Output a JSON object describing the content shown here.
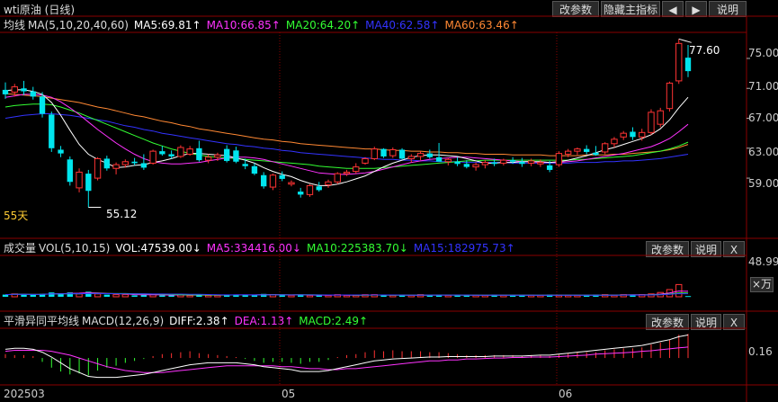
{
  "title": "wti原油 (日线)",
  "toolbar": {
    "modify": "改参数",
    "hide_main": "隐藏主指标",
    "explain": "说明"
  },
  "price_panel": {
    "label": "均线",
    "params": "MA(5,10,20,40,60)",
    "ma5": "MA5:69.81↑",
    "ma10": "MA10:66.85↑",
    "ma20": "MA20:64.20↑",
    "ma40": "MA40:62.58↑",
    "ma60": "MA60:63.46↑",
    "y_ticks": [
      "75.00",
      "71.00",
      "67.00",
      "63.00",
      "59.00"
    ],
    "high_label": "77.60",
    "low_label": "55.12",
    "period_label": "55天"
  },
  "volume_panel": {
    "label": "成交量",
    "params": "VOL(5,10,15)",
    "vol": "VOL:47539.00↓",
    "ma5": "MA5:334416.00↓",
    "ma10": "MA10:225383.70↓",
    "ma15": "MA15:182975.73↑",
    "modify": "改参数",
    "explain": "说明",
    "close": "X",
    "y_tick": "48.99",
    "unit_label": "×万"
  },
  "macd_panel": {
    "label": "平滑异同平均线",
    "params": "MACD(12,26,9)",
    "diff": "DIFF:2.38↑",
    "dea": "DEA:1.13↑",
    "macd": "MACD:2.49↑",
    "modify": "改参数",
    "explain": "说明",
    "close": "X",
    "y_tick": "0.16"
  },
  "x_labels": [
    "202503",
    "05",
    "06"
  ],
  "colors": {
    "up": "#ff3333",
    "down": "#00e5ee",
    "ma5": "#ffffff",
    "ma10": "#ff33ff",
    "ma20": "#33ff33",
    "ma40": "#3333ff",
    "ma60": "#ff8833",
    "grid": "#8a0000"
  },
  "chart_data": {
    "type": "candlestick",
    "ylim": [
      53,
      78
    ],
    "candles": [
      {
        "o": 70.8,
        "h": 71.8,
        "l": 69.6,
        "c": 70.2
      },
      {
        "o": 70.5,
        "h": 71.6,
        "l": 69.9,
        "c": 71.2
      },
      {
        "o": 71.0,
        "h": 72.0,
        "l": 70.1,
        "c": 70.6
      },
      {
        "o": 70.6,
        "h": 71.2,
        "l": 69.5,
        "c": 69.9
      },
      {
        "o": 69.9,
        "h": 70.5,
        "l": 67.1,
        "c": 67.6
      },
      {
        "o": 67.5,
        "h": 67.9,
        "l": 62.5,
        "c": 63.0
      },
      {
        "o": 62.8,
        "h": 63.3,
        "l": 61.8,
        "c": 62.3
      },
      {
        "o": 61.5,
        "h": 61.9,
        "l": 58.0,
        "c": 58.5
      },
      {
        "o": 57.7,
        "h": 60.3,
        "l": 57.1,
        "c": 59.8
      },
      {
        "o": 59.6,
        "h": 60.1,
        "l": 55.1,
        "c": 57.3
      },
      {
        "o": 59.0,
        "h": 61.8,
        "l": 58.7,
        "c": 61.6
      },
      {
        "o": 61.6,
        "h": 62.0,
        "l": 60.0,
        "c": 60.3
      },
      {
        "o": 60.3,
        "h": 61.1,
        "l": 59.5,
        "c": 60.8
      },
      {
        "o": 60.8,
        "h": 61.5,
        "l": 60.4,
        "c": 61.2
      },
      {
        "o": 61.2,
        "h": 61.7,
        "l": 60.7,
        "c": 61.0
      },
      {
        "o": 61.0,
        "h": 62.2,
        "l": 60.1,
        "c": 60.4
      },
      {
        "o": 61.0,
        "h": 62.8,
        "l": 60.8,
        "c": 62.6
      },
      {
        "o": 62.6,
        "h": 63.3,
        "l": 62.0,
        "c": 62.2
      },
      {
        "o": 62.2,
        "h": 62.7,
        "l": 61.6,
        "c": 61.9
      },
      {
        "o": 61.9,
        "h": 63.4,
        "l": 61.7,
        "c": 63.1
      },
      {
        "o": 62.2,
        "h": 63.3,
        "l": 62.0,
        "c": 62.9
      },
      {
        "o": 63.0,
        "h": 64.0,
        "l": 61.2,
        "c": 61.4
      },
      {
        "o": 61.4,
        "h": 62.2,
        "l": 61.0,
        "c": 61.8
      },
      {
        "o": 61.8,
        "h": 62.4,
        "l": 61.3,
        "c": 62.1
      },
      {
        "o": 62.9,
        "h": 63.4,
        "l": 61.1,
        "c": 61.3
      },
      {
        "o": 62.7,
        "h": 63.2,
        "l": 61.0,
        "c": 61.2
      },
      {
        "o": 60.9,
        "h": 61.6,
        "l": 60.2,
        "c": 60.6
      },
      {
        "o": 60.6,
        "h": 61.0,
        "l": 59.4,
        "c": 59.6
      },
      {
        "o": 59.4,
        "h": 59.8,
        "l": 57.6,
        "c": 57.9
      },
      {
        "o": 57.8,
        "h": 59.6,
        "l": 57.4,
        "c": 59.4
      },
      {
        "o": 59.4,
        "h": 59.9,
        "l": 58.6,
        "c": 58.9
      },
      {
        "o": 58.2,
        "h": 58.7,
        "l": 57.9,
        "c": 58.4
      },
      {
        "o": 57.2,
        "h": 57.7,
        "l": 56.4,
        "c": 56.8
      },
      {
        "o": 56.8,
        "h": 58.2,
        "l": 56.5,
        "c": 58.0
      },
      {
        "o": 57.9,
        "h": 58.5,
        "l": 57.2,
        "c": 57.4
      },
      {
        "o": 58.1,
        "h": 58.8,
        "l": 57.7,
        "c": 58.5
      },
      {
        "o": 58.5,
        "h": 59.8,
        "l": 58.2,
        "c": 59.6
      },
      {
        "o": 59.6,
        "h": 60.1,
        "l": 59.3,
        "c": 59.8
      },
      {
        "o": 59.9,
        "h": 61.0,
        "l": 59.6,
        "c": 60.5
      },
      {
        "o": 61.0,
        "h": 61.8,
        "l": 60.8,
        "c": 61.6
      },
      {
        "o": 61.6,
        "h": 63.2,
        "l": 61.4,
        "c": 62.9
      },
      {
        "o": 62.9,
        "h": 63.0,
        "l": 61.7,
        "c": 61.9
      },
      {
        "o": 62.0,
        "h": 63.1,
        "l": 61.7,
        "c": 62.8
      },
      {
        "o": 62.8,
        "h": 63.0,
        "l": 61.5,
        "c": 61.6
      },
      {
        "o": 61.6,
        "h": 62.2,
        "l": 61.1,
        "c": 61.9
      },
      {
        "o": 61.9,
        "h": 62.6,
        "l": 61.4,
        "c": 62.3
      },
      {
        "o": 62.3,
        "h": 62.8,
        "l": 61.6,
        "c": 61.8
      },
      {
        "o": 61.8,
        "h": 63.7,
        "l": 61.5,
        "c": 61.2
      },
      {
        "o": 61.2,
        "h": 61.7,
        "l": 60.7,
        "c": 61.5
      },
      {
        "o": 61.2,
        "h": 61.8,
        "l": 60.6,
        "c": 60.9
      },
      {
        "o": 60.9,
        "h": 61.4,
        "l": 60.3,
        "c": 60.5
      },
      {
        "o": 60.5,
        "h": 61.1,
        "l": 60.0,
        "c": 60.8
      },
      {
        "o": 60.8,
        "h": 61.4,
        "l": 60.3,
        "c": 61.1
      },
      {
        "o": 61.1,
        "h": 61.6,
        "l": 60.6,
        "c": 60.9
      },
      {
        "o": 61.0,
        "h": 61.6,
        "l": 60.7,
        "c": 61.4
      },
      {
        "o": 61.4,
        "h": 61.8,
        "l": 60.9,
        "c": 61.2
      },
      {
        "o": 61.2,
        "h": 61.7,
        "l": 60.5,
        "c": 60.9
      },
      {
        "o": 61.0,
        "h": 61.6,
        "l": 60.6,
        "c": 61.3
      },
      {
        "o": 60.9,
        "h": 61.5,
        "l": 60.5,
        "c": 61.1
      },
      {
        "o": 60.7,
        "h": 61.3,
        "l": 59.8,
        "c": 60.1
      },
      {
        "o": 60.8,
        "h": 62.6,
        "l": 60.5,
        "c": 62.3
      },
      {
        "o": 62.2,
        "h": 62.9,
        "l": 61.8,
        "c": 62.6
      },
      {
        "o": 62.6,
        "h": 63.1,
        "l": 62.1,
        "c": 62.9
      },
      {
        "o": 62.9,
        "h": 63.4,
        "l": 62.2,
        "c": 62.5
      },
      {
        "o": 62.4,
        "h": 63.3,
        "l": 62.0,
        "c": 62.1
      },
      {
        "o": 62.5,
        "h": 63.8,
        "l": 62.2,
        "c": 63.6
      },
      {
        "o": 63.6,
        "h": 64.5,
        "l": 63.1,
        "c": 64.2
      },
      {
        "o": 64.5,
        "h": 65.3,
        "l": 64.1,
        "c": 65.0
      },
      {
        "o": 65.2,
        "h": 65.8,
        "l": 64.1,
        "c": 64.5
      },
      {
        "o": 64.5,
        "h": 65.6,
        "l": 64.0,
        "c": 65.1
      },
      {
        "o": 65.1,
        "h": 68.2,
        "l": 64.8,
        "c": 67.8
      },
      {
        "o": 66.2,
        "h": 68.4,
        "l": 65.8,
        "c": 68.0
      },
      {
        "o": 68.3,
        "h": 71.9,
        "l": 67.9,
        "c": 71.7
      },
      {
        "o": 72.0,
        "h": 77.6,
        "l": 71.6,
        "c": 77.0
      },
      {
        "o": 75.1,
        "h": 76.8,
        "l": 72.5,
        "c": 73.3
      }
    ],
    "ma5": [
      70.7,
      70.8,
      70.8,
      70.6,
      70.2,
      69.1,
      67.4,
      65.4,
      63.5,
      62.2,
      61.5,
      61.0,
      60.4,
      60.5,
      60.7,
      60.8,
      61.1,
      61.3,
      61.6,
      62.0,
      62.3,
      62.3,
      62.2,
      62.1,
      62.0,
      61.7,
      61.4,
      61.0,
      60.4,
      59.9,
      59.5,
      59.2,
      58.7,
      58.3,
      58.0,
      58.0,
      58.2,
      58.5,
      58.9,
      59.3,
      59.9,
      60.5,
      61.0,
      61.4,
      61.8,
      62.0,
      62.1,
      62.1,
      62.0,
      61.9,
      61.6,
      61.3,
      61.0,
      61.0,
      61.1,
      61.1,
      61.2,
      61.2,
      61.2,
      61.1,
      61.2,
      61.4,
      61.7,
      62.0,
      62.4,
      62.8,
      63.1,
      63.5,
      63.9,
      64.3,
      64.8,
      65.6,
      66.8,
      68.4,
      69.8
    ],
    "ma10": [
      69.8,
      70.0,
      70.2,
      70.2,
      70.1,
      69.8,
      69.2,
      68.4,
      67.5,
      66.5,
      65.5,
      64.6,
      63.7,
      62.9,
      62.2,
      61.6,
      61.2,
      61.0,
      60.9,
      60.9,
      61.0,
      61.1,
      61.3,
      61.5,
      61.7,
      61.8,
      61.8,
      61.7,
      61.5,
      61.2,
      60.9,
      60.6,
      60.3,
      60.0,
      59.7,
      59.6,
      59.5,
      59.5,
      59.6,
      59.7,
      59.9,
      60.2,
      60.5,
      60.8,
      61.1,
      61.3,
      61.5,
      61.6,
      61.7,
      61.8,
      61.8,
      61.7,
      61.6,
      61.5,
      61.4,
      61.3,
      61.2,
      61.2,
      61.1,
      61.1,
      61.1,
      61.2,
      61.3,
      61.5,
      61.7,
      61.9,
      62.1,
      62.3,
      62.6,
      62.9,
      63.2,
      63.7,
      64.3,
      65.2,
      66.2
    ],
    "ma20": [
      68.5,
      68.7,
      68.8,
      68.9,
      68.9,
      68.8,
      68.5,
      68.1,
      67.7,
      67.2,
      66.7,
      66.2,
      65.7,
      65.2,
      64.7,
      64.2,
      63.7,
      63.3,
      62.9,
      62.6,
      62.3,
      62.1,
      61.9,
      61.8,
      61.7,
      61.6,
      61.5,
      61.4,
      61.3,
      61.2,
      61.1,
      61.0,
      60.9,
      60.8,
      60.6,
      60.5,
      60.4,
      60.3,
      60.3,
      60.3,
      60.3,
      60.4,
      60.5,
      60.6,
      60.7,
      60.8,
      60.9,
      61.0,
      61.1,
      61.2,
      61.3,
      61.3,
      61.4,
      61.4,
      61.4,
      61.4,
      61.4,
      61.4,
      61.4,
      61.4,
      61.4,
      61.4,
      61.5,
      61.5,
      61.6,
      61.7,
      61.8,
      61.9,
      62.0,
      62.2,
      62.4,
      62.6,
      62.9,
      63.3,
      63.8
    ],
    "ma40": [
      67.0,
      67.2,
      67.4,
      67.5,
      67.6,
      67.6,
      67.5,
      67.4,
      67.2,
      67.0,
      66.8,
      66.6,
      66.3,
      66.0,
      65.8,
      65.5,
      65.3,
      65.0,
      64.8,
      64.6,
      64.4,
      64.2,
      64.0,
      63.8,
      63.6,
      63.5,
      63.3,
      63.2,
      63.0,
      62.9,
      62.7,
      62.6,
      62.4,
      62.3,
      62.2,
      62.1,
      62.0,
      61.9,
      61.8,
      61.7,
      61.6,
      61.5,
      61.5,
      61.4,
      61.4,
      61.3,
      61.3,
      61.2,
      61.2,
      61.2,
      61.1,
      61.1,
      61.1,
      61.1,
      61.1,
      61.0,
      61.0,
      61.0,
      61.0,
      61.0,
      61.0,
      61.0,
      61.1,
      61.1,
      61.1,
      61.2,
      61.2,
      61.3,
      61.3,
      61.4,
      61.5,
      61.6,
      61.8,
      62.0,
      62.2
    ],
    "ma60": [
      70.3,
      70.2,
      70.1,
      70.0,
      69.9,
      69.7,
      69.5,
      69.3,
      69.1,
      68.8,
      68.5,
      68.3,
      68.0,
      67.7,
      67.4,
      67.2,
      66.9,
      66.6,
      66.4,
      66.1,
      65.9,
      65.6,
      65.4,
      65.2,
      65.0,
      64.8,
      64.6,
      64.4,
      64.2,
      64.1,
      63.9,
      63.8,
      63.6,
      63.5,
      63.4,
      63.3,
      63.2,
      63.1,
      63.0,
      62.9,
      62.9,
      62.8,
      62.7,
      62.7,
      62.6,
      62.6,
      62.5,
      62.5,
      62.4,
      62.4,
      62.3,
      62.3,
      62.2,
      62.2,
      62.2,
      62.1,
      62.1,
      62.1,
      62.1,
      62.0,
      62.0,
      62.0,
      62.0,
      62.1,
      62.1,
      62.1,
      62.2,
      62.2,
      62.3,
      62.4,
      62.5,
      62.6,
      62.8,
      63.1,
      63.5
    ],
    "volume_ylim": [
      0,
      50
    ],
    "volume": [
      3,
      4,
      3,
      3,
      4,
      6,
      5,
      6,
      4,
      7,
      4,
      3,
      3,
      3,
      2,
      3,
      3,
      2,
      2,
      3,
      2,
      3,
      2,
      2,
      3,
      3,
      3,
      2,
      4,
      3,
      2,
      2,
      3,
      2,
      2,
      2,
      3,
      2,
      2,
      3,
      3,
      2,
      2,
      2,
      2,
      3,
      2,
      3,
      2,
      2,
      2,
      2,
      2,
      3,
      2,
      2,
      2,
      2,
      2,
      3,
      2,
      2,
      2,
      2,
      3,
      3,
      2,
      3,
      3,
      3,
      4,
      6,
      10,
      17,
      1
    ],
    "macd_ylim": [
      -2.6,
      2.8
    ],
    "macd_bars": [
      0.4,
      0.3,
      0.3,
      0.2,
      -0.4,
      -1.0,
      -1.4,
      -1.7,
      -1.6,
      -1.8,
      -1.3,
      -1.0,
      -0.8,
      -0.5,
      -0.3,
      -0.1,
      0.2,
      0.4,
      0.5,
      0.6,
      0.7,
      0.5,
      0.4,
      0.3,
      0.2,
      0.1,
      -0.1,
      -0.3,
      -0.5,
      -0.4,
      -0.4,
      -0.5,
      -0.6,
      -0.4,
      -0.4,
      -0.2,
      0.1,
      0.3,
      0.4,
      0.6,
      0.8,
      0.7,
      0.8,
      0.7,
      0.7,
      0.7,
      0.6,
      0.6,
      0.5,
      0.4,
      0.3,
      0.3,
      0.3,
      0.3,
      0.3,
      0.3,
      0.2,
      0.3,
      0.3,
      0.2,
      0.4,
      0.5,
      0.6,
      0.6,
      0.6,
      0.8,
      0.9,
      1.0,
      1.0,
      1.1,
      1.4,
      1.6,
      1.9,
      2.4,
      2.5
    ],
    "diff": [
      0.9,
      1.0,
      1.0,
      0.9,
      0.6,
      0.1,
      -0.5,
      -1.1,
      -1.5,
      -1.9,
      -2.0,
      -2.0,
      -2.0,
      -1.9,
      -1.8,
      -1.7,
      -1.5,
      -1.3,
      -1.1,
      -0.9,
      -0.7,
      -0.6,
      -0.5,
      -0.5,
      -0.5,
      -0.5,
      -0.6,
      -0.7,
      -0.9,
      -1.0,
      -1.1,
      -1.2,
      -1.4,
      -1.4,
      -1.4,
      -1.3,
      -1.1,
      -0.9,
      -0.7,
      -0.5,
      -0.3,
      -0.2,
      -0.1,
      -0.05,
      0.0,
      0.05,
      0.1,
      0.1,
      0.15,
      0.15,
      0.15,
      0.15,
      0.15,
      0.2,
      0.2,
      0.2,
      0.2,
      0.25,
      0.3,
      0.3,
      0.4,
      0.5,
      0.6,
      0.7,
      0.8,
      0.9,
      1.0,
      1.1,
      1.2,
      1.3,
      1.5,
      1.7,
      1.9,
      2.2,
      2.38
    ],
    "dea": [
      0.7,
      0.8,
      0.8,
      0.8,
      0.8,
      0.7,
      0.5,
      0.3,
      0.0,
      -0.3,
      -0.6,
      -0.9,
      -1.1,
      -1.3,
      -1.4,
      -1.5,
      -1.5,
      -1.5,
      -1.4,
      -1.3,
      -1.2,
      -1.1,
      -1.0,
      -0.9,
      -0.8,
      -0.8,
      -0.8,
      -0.8,
      -0.8,
      -0.8,
      -0.9,
      -0.9,
      -1.0,
      -1.1,
      -1.1,
      -1.2,
      -1.2,
      -1.1,
      -1.1,
      -1.0,
      -0.9,
      -0.8,
      -0.7,
      -0.6,
      -0.5,
      -0.4,
      -0.3,
      -0.3,
      -0.2,
      -0.2,
      -0.1,
      -0.1,
      -0.05,
      0.0,
      0.0,
      0.05,
      0.05,
      0.1,
      0.1,
      0.1,
      0.15,
      0.2,
      0.25,
      0.3,
      0.4,
      0.45,
      0.5,
      0.55,
      0.6,
      0.7,
      0.75,
      0.85,
      0.95,
      1.05,
      1.13
    ]
  }
}
